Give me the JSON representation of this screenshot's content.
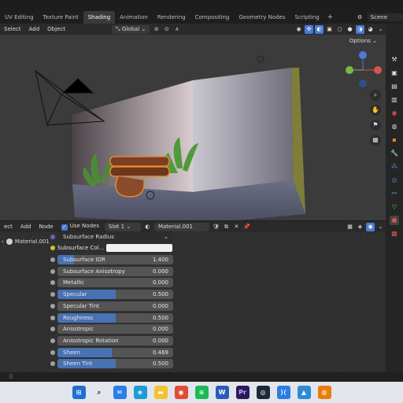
{
  "workspace_tabs": [
    "UV Editing",
    "Texture Paint",
    "Shading",
    "Animation",
    "Rendering",
    "Compositing",
    "Geometry Nodes",
    "Scripting"
  ],
  "active_tab": "Shading",
  "scene": {
    "label": "Scene"
  },
  "viewport_header": {
    "select": "Select",
    "add": "Add",
    "object": "Object",
    "transform": "Global"
  },
  "viewport": {
    "options": "Options"
  },
  "node_header": {
    "select": "ect",
    "add": "Add",
    "node": "Node",
    "use_nodes": "Use Nodes",
    "slot": "Slot 1",
    "material": "Material.001"
  },
  "outline": {
    "material": "Material.001"
  },
  "node": {
    "subsurface_radius": "Subsurface Radius",
    "subsurface_color": "Subsurface Col...",
    "rows": [
      {
        "label": "Subsurface IOR",
        "value": "1.400",
        "fill": 0.14
      },
      {
        "label": "Subsurface Anisotropy",
        "value": "0.000",
        "fill": 0
      },
      {
        "label": "Metallic",
        "value": "0.000",
        "fill": 0
      },
      {
        "label": "Specular",
        "value": "0.500",
        "fill": 0.5
      },
      {
        "label": "Specular Tint",
        "value": "0.000",
        "fill": 0
      },
      {
        "label": "Roughness",
        "value": "0.500",
        "fill": 0.5
      },
      {
        "label": "Anisotropic",
        "value": "0.000",
        "fill": 0
      },
      {
        "label": "Anisotropic Rotation",
        "value": "0.000",
        "fill": 0
      },
      {
        "label": "Sheen",
        "value": "0.469",
        "fill": 0.469
      },
      {
        "label": "Sheen Tint",
        "value": "0.500",
        "fill": 0.5
      }
    ]
  }
}
